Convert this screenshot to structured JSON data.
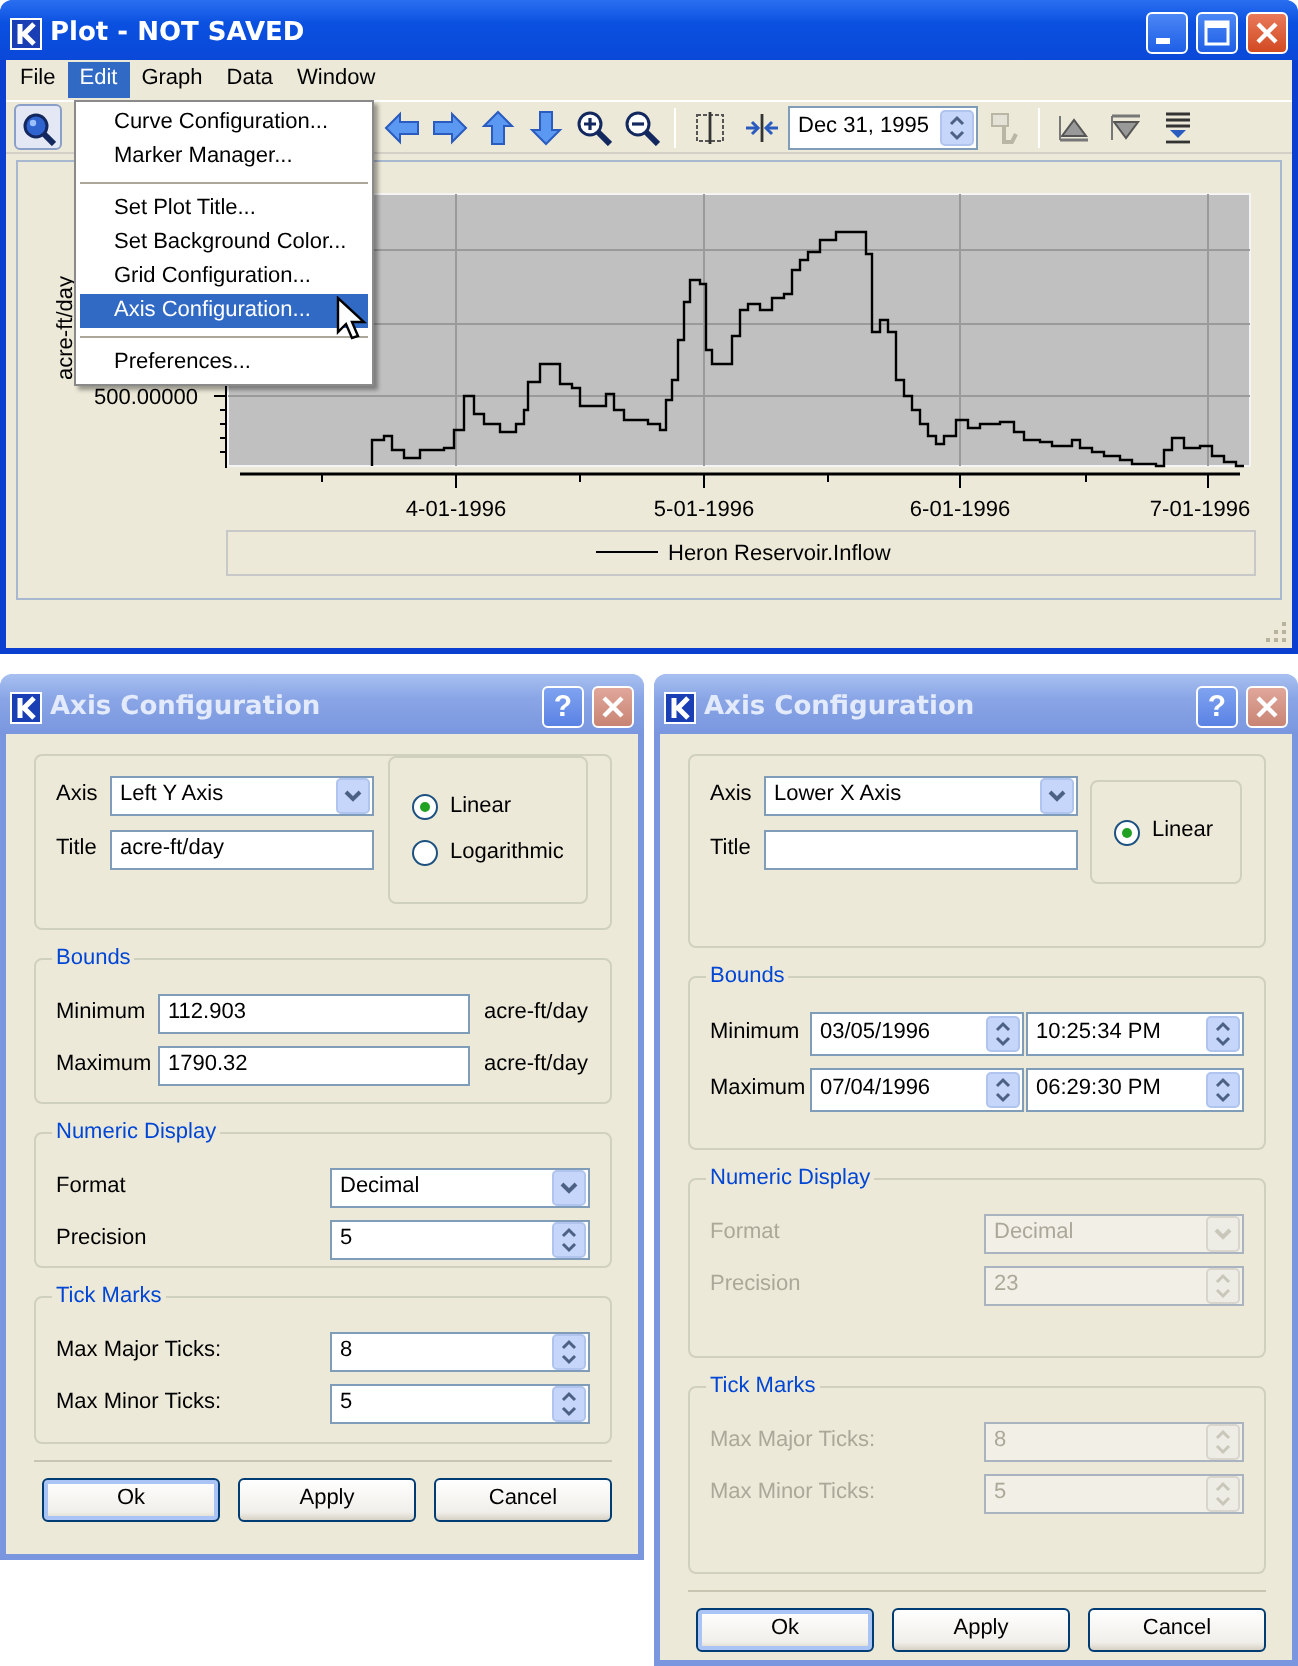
{
  "plot_window": {
    "title": "Plot - NOT SAVED",
    "menu": [
      {
        "label": "File",
        "selected": false
      },
      {
        "label": "Edit",
        "selected": true
      },
      {
        "label": "Graph",
        "selected": false
      },
      {
        "label": "Data",
        "selected": false
      },
      {
        "label": "Window",
        "selected": false
      }
    ],
    "date_field": "Dec 31, 1995",
    "chart": {
      "y_label": "acre-ft/day",
      "y_tick": "500.00000",
      "x_ticks": [
        "4-01-1996",
        "5-01-1996",
        "6-01-1996",
        "7-01-1996"
      ],
      "legend": "Heron Reservoir.Inflow"
    },
    "edit_menu": [
      {
        "kind": "item",
        "label": "Curve Configuration...",
        "selected": false
      },
      {
        "kind": "item",
        "label": "Marker Manager...",
        "selected": false
      },
      {
        "kind": "separator"
      },
      {
        "kind": "item",
        "label": "Set Plot Title...",
        "selected": false
      },
      {
        "kind": "item",
        "label": "Set Background Color...",
        "selected": false
      },
      {
        "kind": "item",
        "label": "Grid Configuration...",
        "selected": false
      },
      {
        "kind": "item",
        "label": "Axis Configuration...",
        "selected": true
      },
      {
        "kind": "separator"
      },
      {
        "kind": "item",
        "label": "Preferences...",
        "selected": false
      }
    ]
  },
  "dialogs": [
    {
      "title": "Axis Configuration",
      "help": "?",
      "fields": [
        {
          "label": "Axis",
          "kind": "select",
          "value": "Left Y Axis"
        },
        {
          "label": "Title",
          "kind": "text",
          "value": "acre-ft/day"
        }
      ],
      "scale": [
        {
          "label": "Linear",
          "selected": true
        },
        {
          "label": "Logarithmic",
          "selected": false
        }
      ],
      "sections": [
        {
          "legend": "Bounds",
          "disabled": false,
          "rows": [
            {
              "kind": "number",
              "label": "Minimum",
              "value": "112.903",
              "unit": "acre-ft/day"
            },
            {
              "kind": "number",
              "label": "Maximum",
              "value": "1790.32",
              "unit": "acre-ft/day"
            }
          ]
        },
        {
          "legend": "Numeric Display",
          "disabled": false,
          "rows": [
            {
              "kind": "select",
              "label": "Format",
              "value": "Decimal"
            },
            {
              "kind": "spinner",
              "label": "Precision",
              "value": "5"
            }
          ]
        },
        {
          "legend": "Tick Marks",
          "disabled": false,
          "rows": [
            {
              "kind": "spinner",
              "label": "Max Major Ticks:",
              "value": "8"
            },
            {
              "kind": "spinner",
              "label": "Max Minor Ticks:",
              "value": "5"
            }
          ]
        }
      ],
      "buttons": [
        {
          "label": "Ok",
          "focused": true
        },
        {
          "label": "Apply",
          "focused": false
        },
        {
          "label": "Cancel",
          "focused": false
        }
      ]
    },
    {
      "title": "Axis Configuration",
      "help": "?",
      "fields": [
        {
          "label": "Axis",
          "kind": "select",
          "value": "Lower X Axis"
        },
        {
          "label": "Title",
          "kind": "text"
        }
      ],
      "scale": [
        {
          "label": "Linear",
          "selected": true
        }
      ],
      "sections": [
        {
          "legend": "Bounds",
          "disabled": false,
          "rows": [
            {
              "kind": "datetime",
              "label": "Minimum",
              "date": "03/05/1996",
              "time": "10:25:34 PM"
            },
            {
              "kind": "datetime",
              "label": "Maximum",
              "date": "07/04/1996",
              "time": "06:29:30 PM"
            }
          ]
        },
        {
          "legend": "Numeric Display",
          "disabled": true,
          "rows": [
            {
              "kind": "select",
              "label": "Format",
              "value": "Decimal"
            },
            {
              "kind": "spinner",
              "label": "Precision",
              "value": "23"
            }
          ]
        },
        {
          "legend": "Tick Marks",
          "disabled": true,
          "rows": [
            {
              "kind": "spinner",
              "label": "Max Major Ticks:",
              "value": "8"
            },
            {
              "kind": "spinner",
              "label": "Max Minor Ticks:",
              "value": "5"
            }
          ]
        }
      ],
      "buttons": [
        {
          "label": "Ok",
          "focused": true
        },
        {
          "label": "Apply",
          "focused": false
        },
        {
          "label": "Cancel",
          "focused": false
        }
      ]
    }
  ]
}
